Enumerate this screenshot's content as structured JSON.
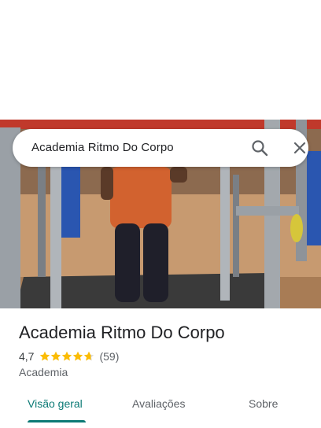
{
  "search": {
    "query": "Academia Ritmo Do Corpo",
    "search_icon": "search-icon",
    "close_icon": "close-icon"
  },
  "place": {
    "title": "Academia Ritmo Do Corpo",
    "rating": "4,7",
    "rating_fraction": 0.94,
    "review_count": "(59)",
    "category": "Academia"
  },
  "tabs": [
    {
      "label": "Visão geral",
      "active": true
    },
    {
      "label": "Avaliações",
      "active": false
    },
    {
      "label": "Sobre",
      "active": false
    }
  ],
  "colors": {
    "accent": "#0b7a75",
    "star": "#fbbc04",
    "star_empty": "#dadce0"
  }
}
